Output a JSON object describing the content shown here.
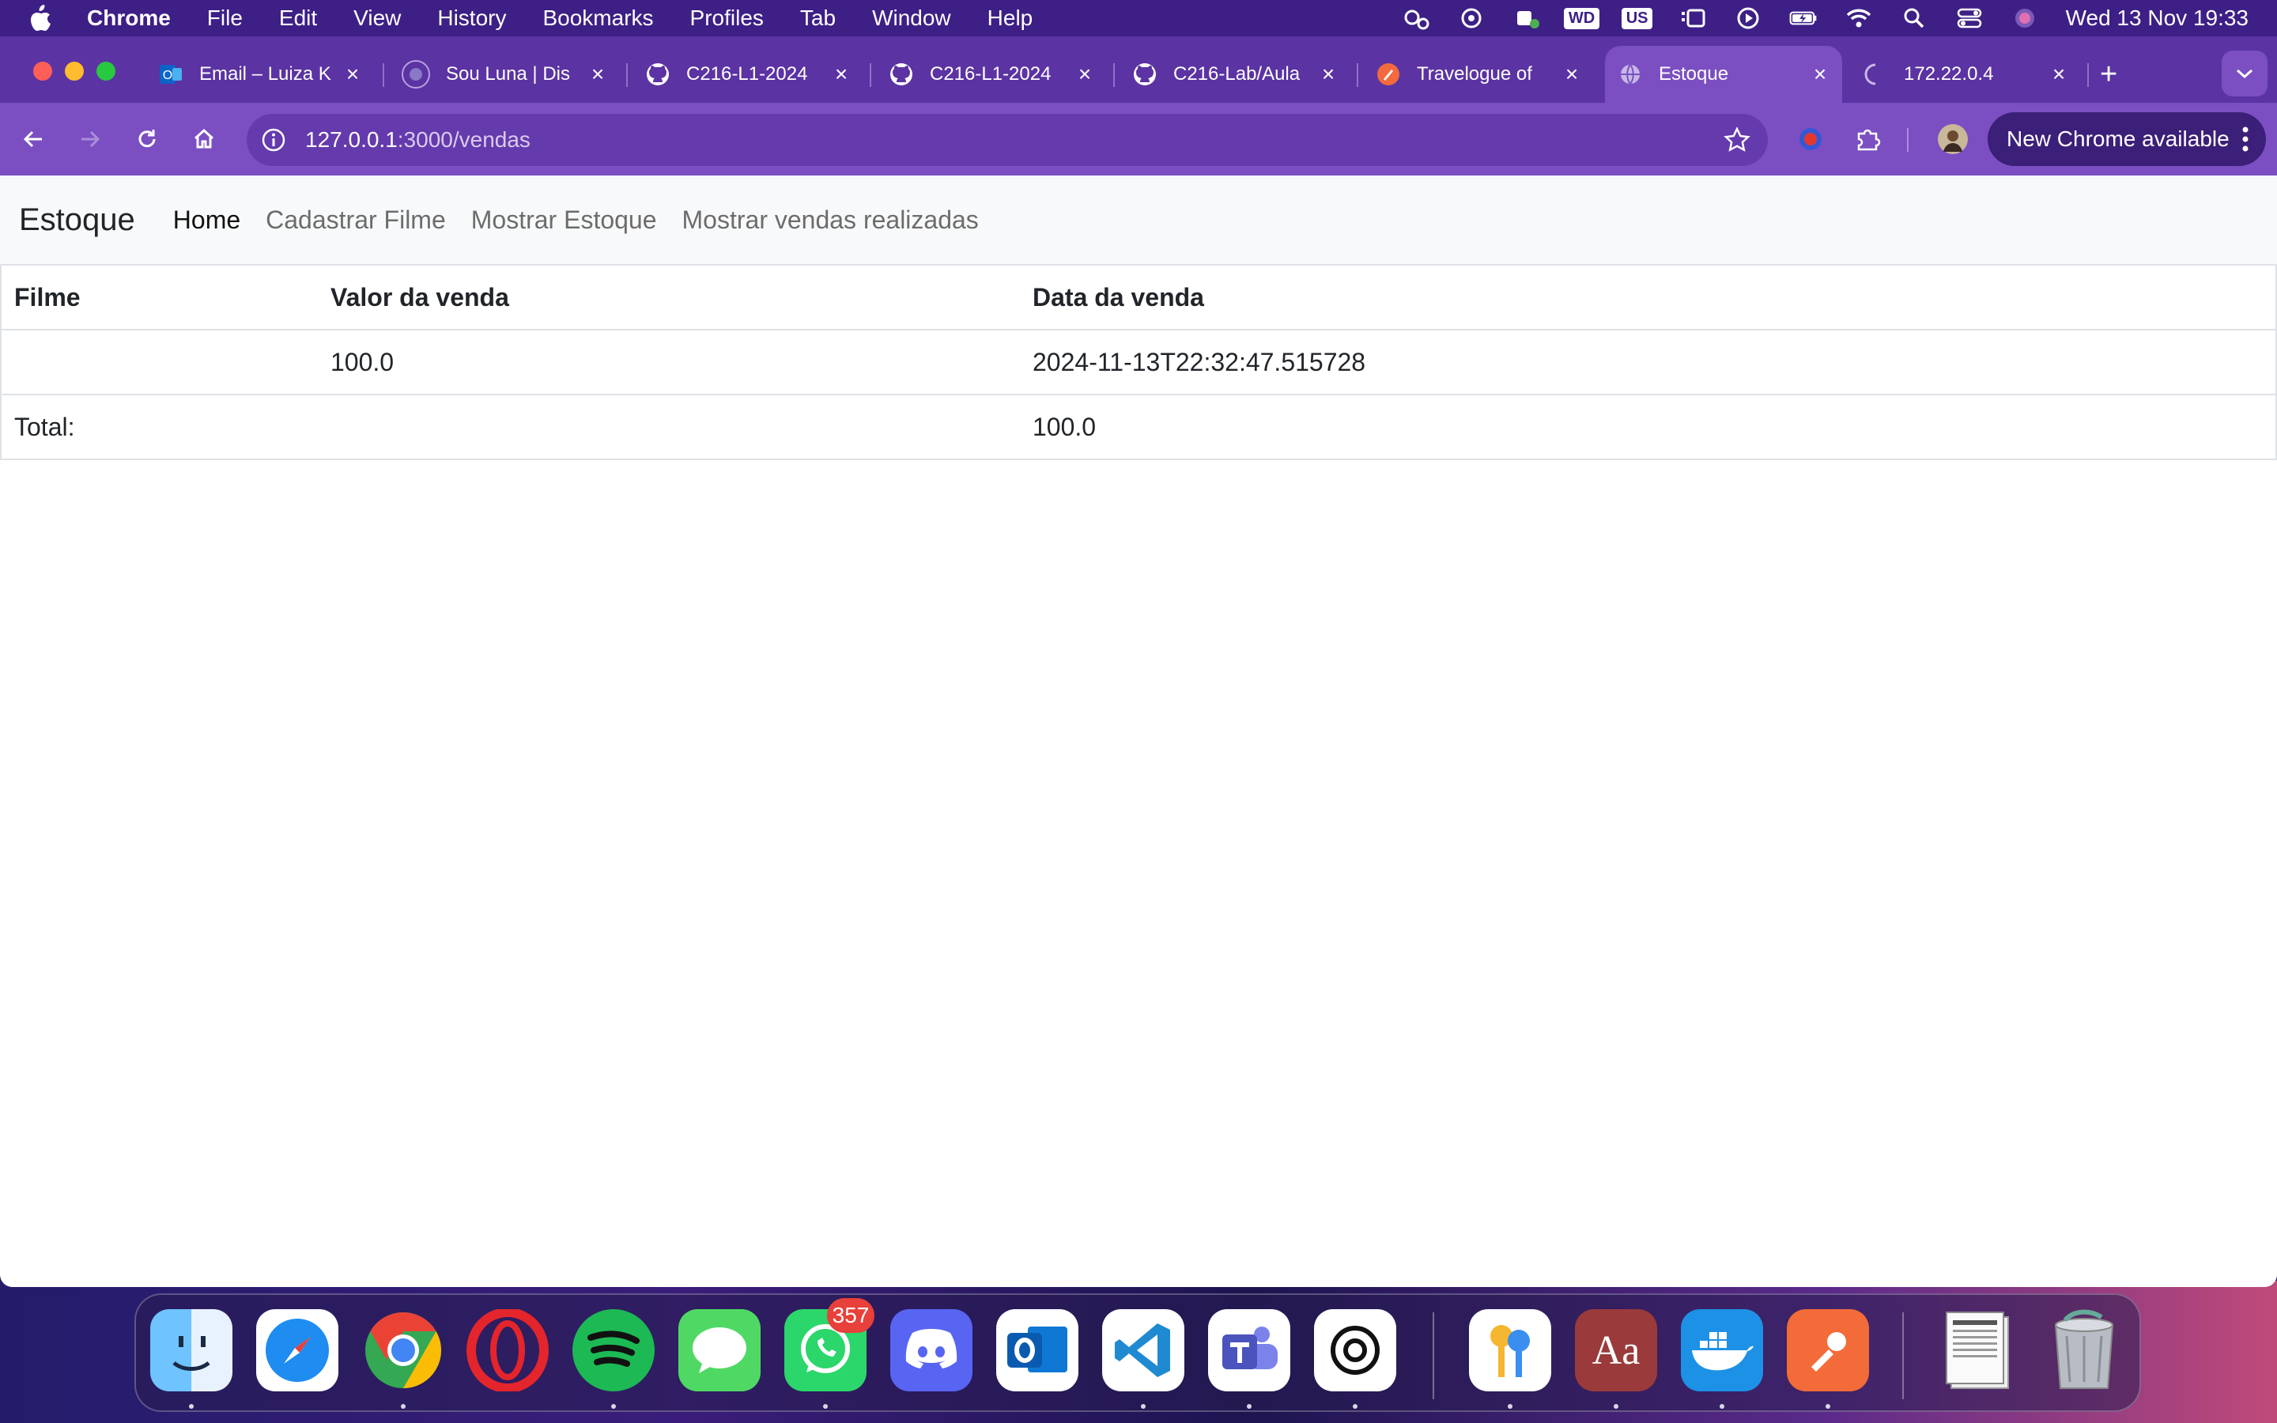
{
  "menubar": {
    "app_name": "Chrome",
    "menus": [
      "File",
      "Edit",
      "View",
      "History",
      "Bookmarks",
      "Profiles",
      "Tab",
      "Window",
      "Help"
    ],
    "input_source": "US",
    "wd_label": "WD",
    "clock": "Wed 13 Nov  19:33"
  },
  "browser": {
    "tabs": [
      {
        "title": "Email – Luiza K",
        "favicon": "outlook-icon"
      },
      {
        "title": "Sou Luna | Dis",
        "favicon": "discord-icon"
      },
      {
        "title": "C216-L1-2024",
        "favicon": "github-icon"
      },
      {
        "title": "C216-L1-2024",
        "favicon": "github-icon"
      },
      {
        "title": "C216-Lab/Aula",
        "favicon": "github-icon"
      },
      {
        "title": "Travelogue of",
        "favicon": "travelogue-icon"
      },
      {
        "title": "Estoque",
        "favicon": "globe-icon",
        "active": true
      },
      {
        "title": "172.22.0.4",
        "favicon": "loading-icon"
      }
    ],
    "url_host": "127.0.0.1",
    "url_path": ":3000/vendas",
    "update_button": "New Chrome available",
    "colors": {
      "tabstrip": "#5b33a3",
      "toolbar": "#7b4fc2"
    }
  },
  "page": {
    "brand": "Estoque",
    "nav": [
      "Home",
      "Cadastrar Filme",
      "Mostrar Estoque",
      "Mostrar vendas realizadas"
    ],
    "table": {
      "headers": [
        "Filme",
        "Valor da venda",
        "Data da venda"
      ],
      "rows": [
        {
          "filme": "",
          "valor": "100.0",
          "data": "2024-11-13T22:32:47.515728"
        }
      ],
      "total_label": "Total:",
      "total_value": "100.0"
    }
  },
  "dock": {
    "apps": [
      "Finder",
      "Safari",
      "Chrome",
      "Opera",
      "Spotify",
      "Messages",
      "WhatsApp",
      "Discord",
      "Outlook",
      "Visual Studio Code",
      "Microsoft Teams",
      "ChatGPT",
      "Passwords",
      "Dictionary",
      "Docker",
      "Postman",
      "Documents",
      "Trash"
    ],
    "whatsapp_badge": "357",
    "dictionary_label": "Aa"
  }
}
